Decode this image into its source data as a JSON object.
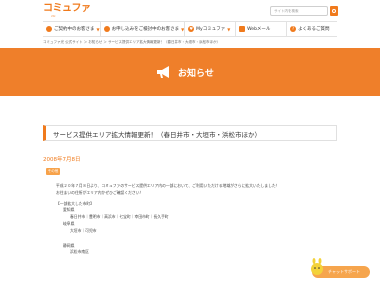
{
  "header": {
    "logo_main": "コミュファ",
    "logo_sub": "ctc",
    "search_placeholder": "サイト内を検索"
  },
  "nav": {
    "items": [
      {
        "label": "ご契約中のお客さま",
        "icon": "circle-icon"
      },
      {
        "label": "お申し込みをご検討中のお客さま",
        "icon": "circle-icon"
      },
      {
        "label": "Myコミュファ",
        "icon": "heart-icon"
      },
      {
        "label": "Webメール",
        "icon": "mail-icon"
      },
      {
        "label": "よくあるご質問",
        "icon": "question-icon"
      }
    ]
  },
  "breadcrumb": "コミュファ光 公式サイト ＞ お知らせ ＞ サービス提供エリア拡大情報更新！（春日井市・大垣市・浜松市ほか）",
  "hero": {
    "title": "お知らせ",
    "icon": "megaphone-icon",
    "color": "#ef7f2a"
  },
  "article": {
    "title": "サービス提供エリア拡大情報更新！（春日井市・大垣市・浜松市ほか）",
    "date": "2008年7月8日",
    "category": "その他",
    "intro_1": "平成２０年７月８日より、コミュファのサービス提供エリア内の一部において、ご利用いただける地域がさらに拡大いたしました！",
    "intro_2": "お住まいの住所がエリア内かぜひご確認ください！",
    "list_heading": "【一部拡大した市町】",
    "pref_1": "愛知県",
    "pref_1_cities": "春日井市｜豊明市｜高浜市｜七宝町｜幸田市町｜長久手町",
    "pref_2": "岐阜県",
    "pref_2_cities": "大垣市｜可児市",
    "pref_3": "静岡県",
    "pref_3_cities": "浜松市南区"
  },
  "chat": {
    "label": "チャットサポート"
  }
}
